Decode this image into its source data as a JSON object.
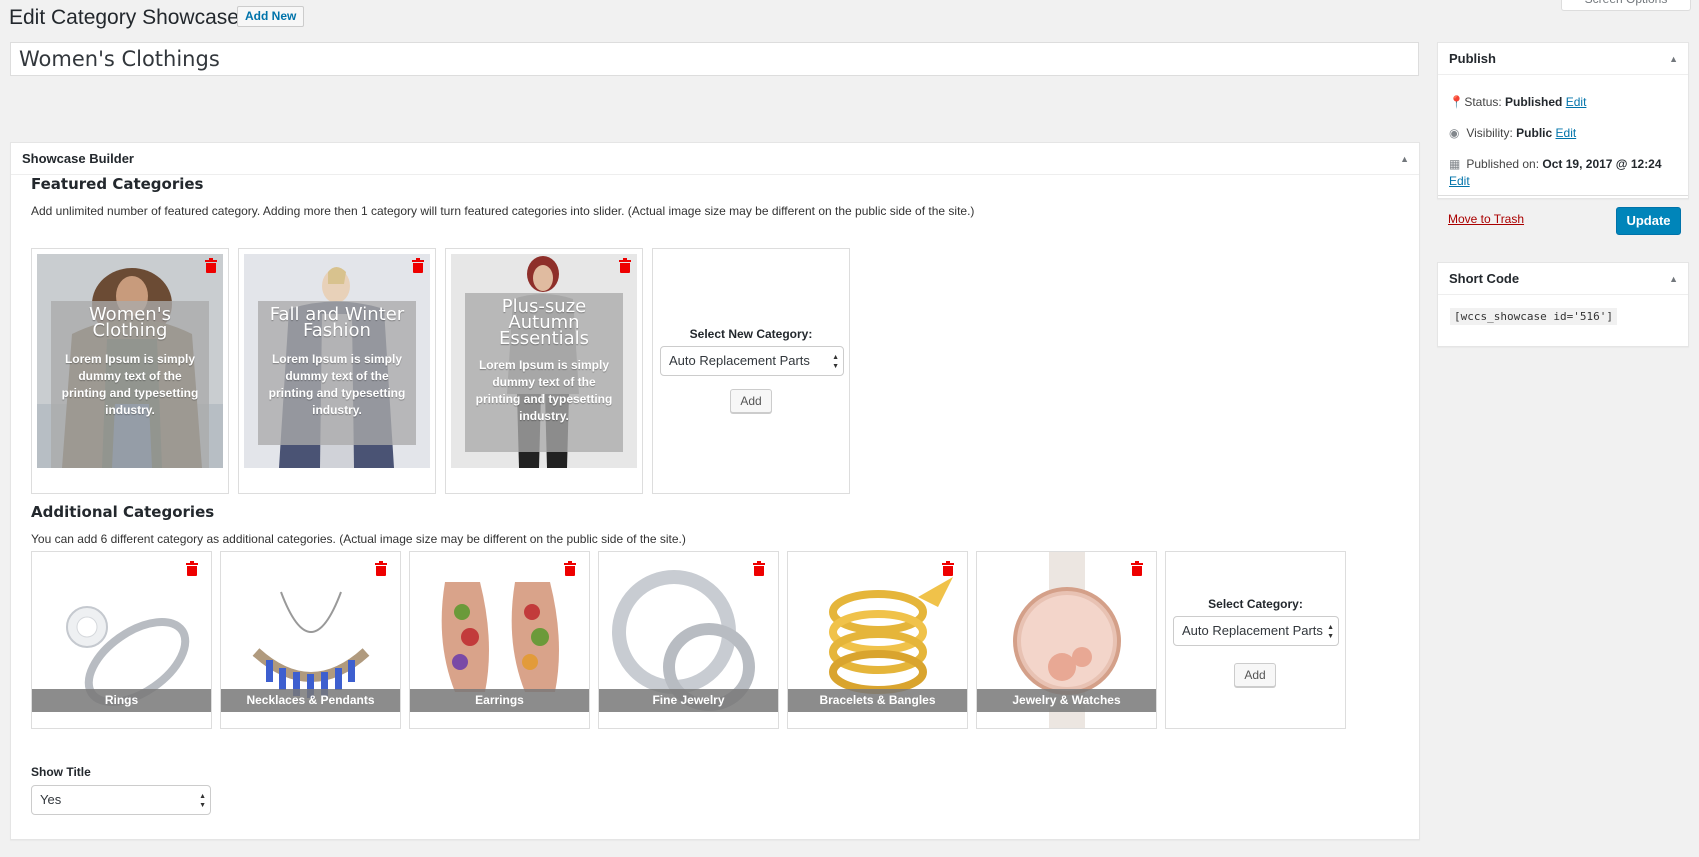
{
  "header": {
    "title": "Edit Category Showcase",
    "add_new": "Add New",
    "screen_options": "Screen Options"
  },
  "post_title": "Women's Clothings",
  "builder": {
    "title": "Showcase Builder",
    "featured": {
      "heading": "Featured Categories",
      "description": "Add unlimited number of featured category. Adding more then 1 category will turn featured categories into slider. (Actual image size may be different on the public side of the site.)",
      "items": [
        {
          "title": "Women's Clothing",
          "desc": "Lorem Ipsum is simply dummy text of the printing and typesetting industry."
        },
        {
          "title": "Fall and Winter Fashion",
          "desc": "Lorem Ipsum is simply dummy text of the printing and typesetting industry."
        },
        {
          "title": "Plus-suze Autumn Essentials",
          "desc": "Lorem Ipsum is simply dummy text of the printing and typesetting industry."
        }
      ],
      "select_label": "Select New Category:",
      "select_value": "Auto Replacement Parts",
      "add_label": "Add"
    },
    "additional": {
      "heading": "Additional Categories",
      "description": "You can add 6 different category as additional categories. (Actual image size may be different on the public side of the site.)",
      "items": [
        {
          "label": "Rings"
        },
        {
          "label": "Necklaces & Pendants"
        },
        {
          "label": "Earrings"
        },
        {
          "label": "Fine Jewelry"
        },
        {
          "label": "Bracelets & Bangles"
        },
        {
          "label": "Jewelry & Watches"
        }
      ],
      "select_label": "Select Category:",
      "select_value": "Auto Replacement Parts",
      "add_label": "Add"
    },
    "show_title_label": "Show Title",
    "show_title_value": "Yes"
  },
  "publish": {
    "title": "Publish",
    "status_label": "Status:",
    "status_value": "Published",
    "visibility_label": "Visibility:",
    "visibility_value": "Public",
    "published_label": "Published on:",
    "published_value": "Oct 19, 2017 @ 12:24",
    "edit": "Edit",
    "trash": "Move to Trash",
    "update": "Update"
  },
  "shortcode": {
    "title": "Short Code",
    "code": "[wccs_showcase id='516']"
  },
  "colors": {
    "primary": "#0085ba",
    "trash_red": "#e00000",
    "link": "#0073aa"
  }
}
